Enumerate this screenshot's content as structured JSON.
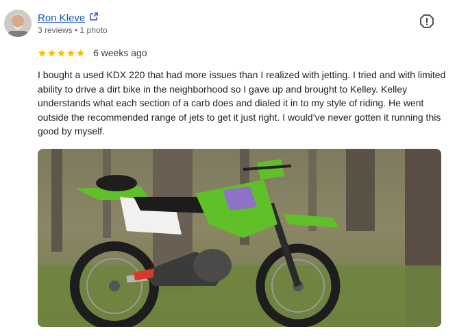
{
  "reviewer": {
    "name": "Ron Kleve",
    "meta": "3 reviews • 1 photo"
  },
  "review": {
    "rating": 5,
    "date": "6 weeks ago",
    "text": "I bought a used KDX 220 that had more issues than I realized with jetting. I tried and with limited ability to drive a dirt bike in the neighborhood so I gave up and brought to Kelley. Kelley understands what each section of a carb does and dialed it in to my style of riding. He went outside the recommended range of jets to get it just right. I would’ve never gotten it running this good by myself."
  },
  "colors": {
    "link": "#1a57c6",
    "star": "#fbbc04",
    "bike_green": "#5fc127"
  },
  "icons": {
    "external": "external-link-icon",
    "flag": "report-icon",
    "star": "star-icon"
  }
}
